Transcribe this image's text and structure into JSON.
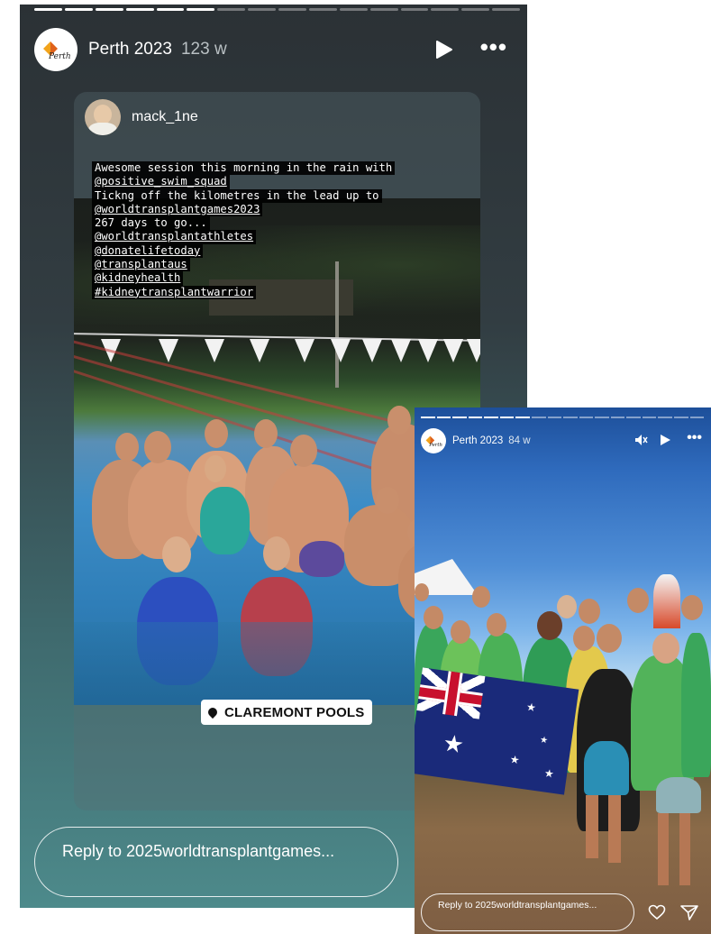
{
  "story_main": {
    "account": "Perth 2023",
    "time_ago": "123 w",
    "avatar_text": "Perth",
    "shared_post": {
      "username": "mack_1ne",
      "caption_lines": [
        "Awesome session this morning in the rain with",
        "@positive_swim_squad",
        "Tickng off the kilometres in the lead up to",
        "@worldtransplantgames2023",
        "267 days to go...",
        "@worldtransplantathletes",
        "@donatelifetoday",
        "@transplantaus",
        "@kidneyhealth",
        "#kidneytransplantwarrior"
      ],
      "location": "CLAREMONT POOLS"
    },
    "reply_placeholder": "Reply to 2025worldtransplantgames..."
  },
  "story_secondary": {
    "account": "Perth 2023",
    "time_ago": "84 w",
    "avatar_text": "Perth",
    "reply_placeholder": "Reply to 2025worldtransplantgames..."
  }
}
